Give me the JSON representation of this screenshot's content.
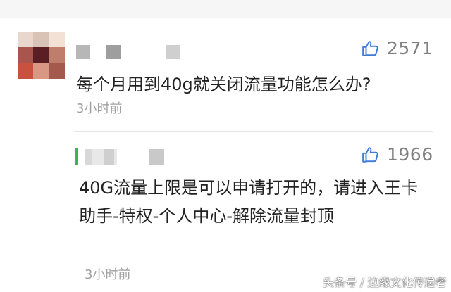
{
  "comment": {
    "likes": "2571",
    "text": "每个月用到40g就关闭流量功能怎么办?",
    "time": "3小时前"
  },
  "reply": {
    "likes": "1966",
    "text": "40G流量上限是可以申请打开的，请进入王卡助手-特权-个人中心-解除流量封顶",
    "time": "3小时前"
  },
  "watermark": "头条号 / 边缘文化传递者",
  "icons": {
    "like": "thumbs-up-icon"
  },
  "colors": {
    "reply_accent": "#3cb54a",
    "like_icon": "#3f7ad6"
  }
}
